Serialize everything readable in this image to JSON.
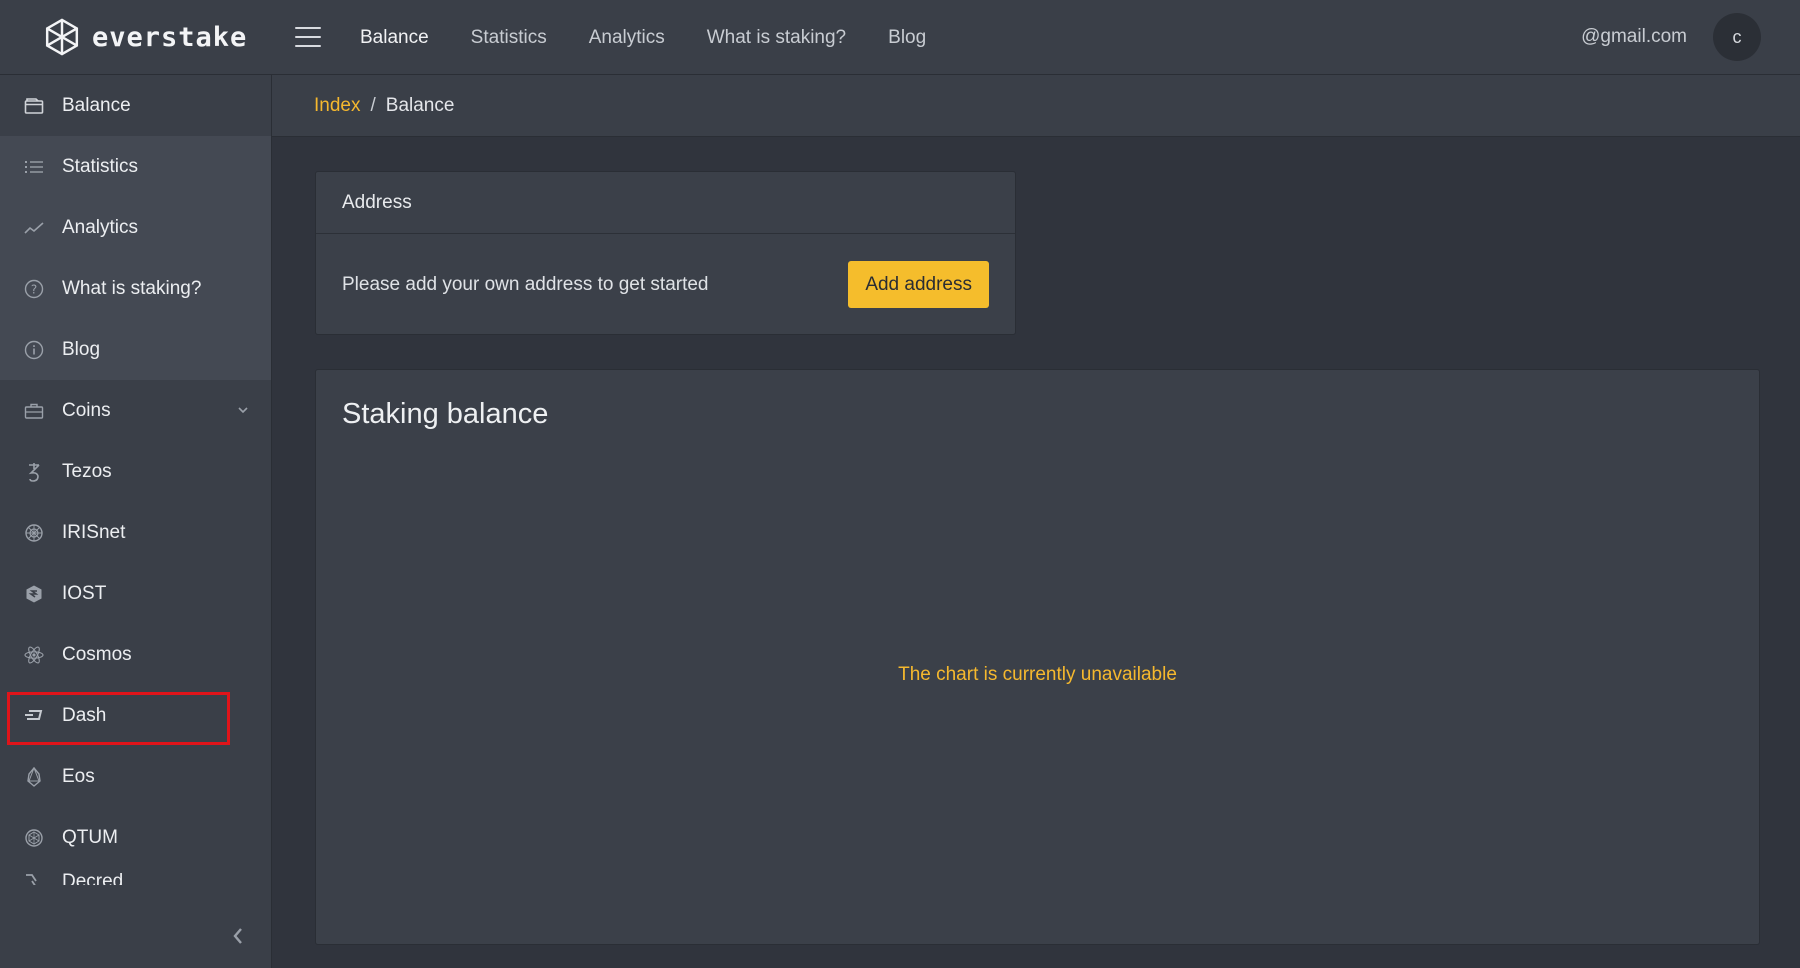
{
  "brand": {
    "name": "everstake"
  },
  "topnav": {
    "items": [
      {
        "label": "Balance"
      },
      {
        "label": "Statistics"
      },
      {
        "label": "Analytics"
      },
      {
        "label": "What is staking?"
      },
      {
        "label": "Blog"
      }
    ],
    "email": "@gmail.com",
    "avatar_initial": "c"
  },
  "sidebar": {
    "items": [
      {
        "label": "Balance",
        "icon": "wallet-icon"
      },
      {
        "label": "Statistics",
        "icon": "list-icon"
      },
      {
        "label": "Analytics",
        "icon": "trend-line-icon"
      },
      {
        "label": "What is staking?",
        "icon": "question-circle-icon"
      },
      {
        "label": "Blog",
        "icon": "info-circle-icon"
      },
      {
        "label": "Coins",
        "icon": "briefcase-icon"
      },
      {
        "label": "Tezos",
        "icon": "tezos-icon"
      },
      {
        "label": "IRISnet",
        "icon": "irisnet-icon"
      },
      {
        "label": "IOST",
        "icon": "iost-icon"
      },
      {
        "label": "Cosmos",
        "icon": "cosmos-icon"
      },
      {
        "label": "Dash",
        "icon": "dash-icon"
      },
      {
        "label": "Eos",
        "icon": "eos-icon"
      },
      {
        "label": "QTUM",
        "icon": "qtum-icon"
      },
      {
        "label": "Decred",
        "icon": "decred-icon"
      }
    ]
  },
  "breadcrumb": {
    "index": "Index",
    "separator": "/",
    "current": "Balance"
  },
  "address_card": {
    "title": "Address",
    "message": "Please add your own address to get started",
    "button": "Add address"
  },
  "staking_card": {
    "title": "Staking balance",
    "chart_message": "The chart is currently unavailable"
  },
  "colors": {
    "accent": "#f5bd2c",
    "highlight": "#e0141a",
    "background": "#30343d",
    "panel": "#3a3f48"
  }
}
